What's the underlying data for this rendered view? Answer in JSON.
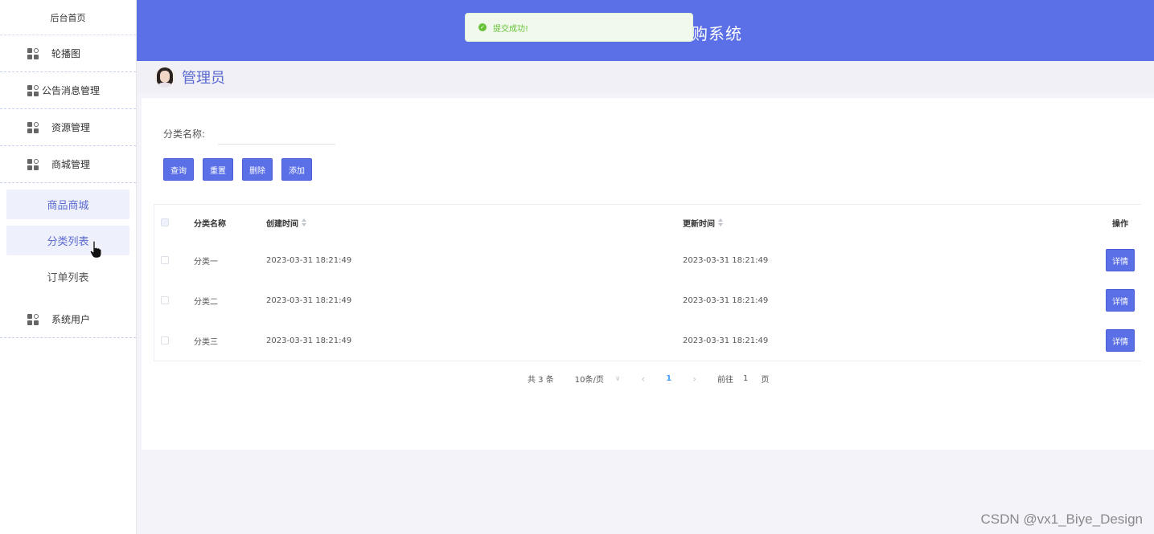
{
  "sidebar": {
    "home": "后台首页",
    "menu": [
      {
        "label": "轮播图",
        "icon": "grid-icon"
      },
      {
        "label": "公告消息管理",
        "icon": "grid-icon"
      },
      {
        "label": "资源管理",
        "icon": "grid-icon"
      },
      {
        "label": "商城管理",
        "icon": "grid-icon"
      }
    ],
    "submenu": [
      {
        "label": "商品商城"
      },
      {
        "label": "分类列表"
      },
      {
        "label": "订单列表"
      }
    ],
    "after": [
      {
        "label": "系统用户",
        "icon": "grid-icon"
      }
    ]
  },
  "header": {
    "title": "购系统"
  },
  "toast": {
    "message": "提交成功!",
    "type": "success"
  },
  "user": {
    "name": "管理员"
  },
  "search": {
    "label": "分类名称:",
    "value": "",
    "placeholder": ""
  },
  "buttons": {
    "query": "查询",
    "reset": "重置",
    "delete": "删除",
    "add": "添加"
  },
  "table": {
    "columns": [
      "分类名称",
      "创建时间",
      "更新时间",
      "操作"
    ],
    "rows": [
      {
        "name": "分类一",
        "created": "2023-03-31 18:21:49",
        "updated": "2023-03-31 18:21:49",
        "action": "详情"
      },
      {
        "name": "分类二",
        "created": "2023-03-31 18:21:49",
        "updated": "2023-03-31 18:21:49",
        "action": "详情"
      },
      {
        "name": "分类三",
        "created": "2023-03-31 18:21:49",
        "updated": "2023-03-31 18:21:49",
        "action": "详情"
      }
    ]
  },
  "pagination": {
    "total": "共 3 条",
    "page_size": "10条/页",
    "current_page": "1",
    "goto_label": "前往",
    "goto_value": "1",
    "page_suffix": "页"
  },
  "watermark": "CSDN @vx1_Biye_Design",
  "colors": {
    "primary": "#5b6fe6",
    "success": "#67c23a",
    "link": "#409eff"
  }
}
